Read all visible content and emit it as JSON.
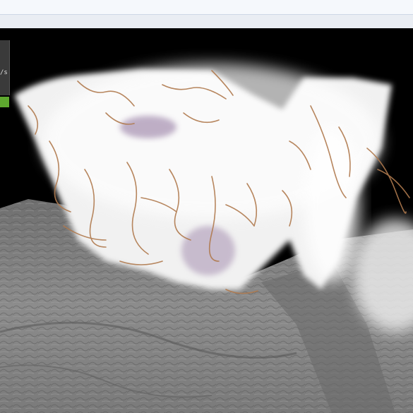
{
  "hud": {
    "fps_text": "/s",
    "status_color": "#5ea82f"
  },
  "scene": {
    "background_color": "#000000",
    "terrain_color": "#8f8f8f",
    "cloud_color": "#f3f3f3",
    "filament_color": "#b07a4e",
    "volume_highlight_color": "#a58fb0"
  },
  "icons": {
    "status_indicator": "green-status-icon"
  }
}
